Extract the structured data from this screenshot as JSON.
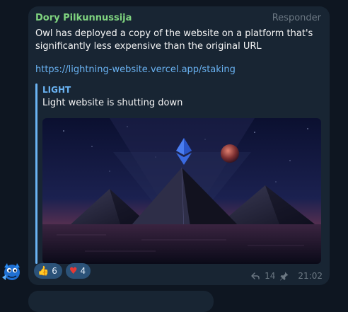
{
  "message": {
    "sender": "Dory Pilkunnussija",
    "reply_action": "Responder",
    "text": "Owl has deployed a copy of the website on a platform that's significantly less expensive than the original URL",
    "link": "https://lightning-website.vercel.app/staking",
    "preview": {
      "title": "LIGHT",
      "description": "Light website is shutting down",
      "image_icon": "pyramid-landscape-image"
    },
    "reactions": [
      {
        "emoji": "👍",
        "icon": "thumbs-up-icon",
        "count": "6"
      },
      {
        "emoji": "♥",
        "icon": "heart-icon",
        "count": "4"
      }
    ],
    "forwards": "14",
    "time": "21:02",
    "pin_icon": "pin-icon",
    "forward_icon": "forward-icon"
  },
  "colors": {
    "background": "#0e1621",
    "bubble": "#182533",
    "sender": "#7fd37f",
    "link": "#6ab3f3",
    "muted": "#6c7883",
    "reaction_bg": "#2b5278",
    "heart": "#e53935"
  }
}
